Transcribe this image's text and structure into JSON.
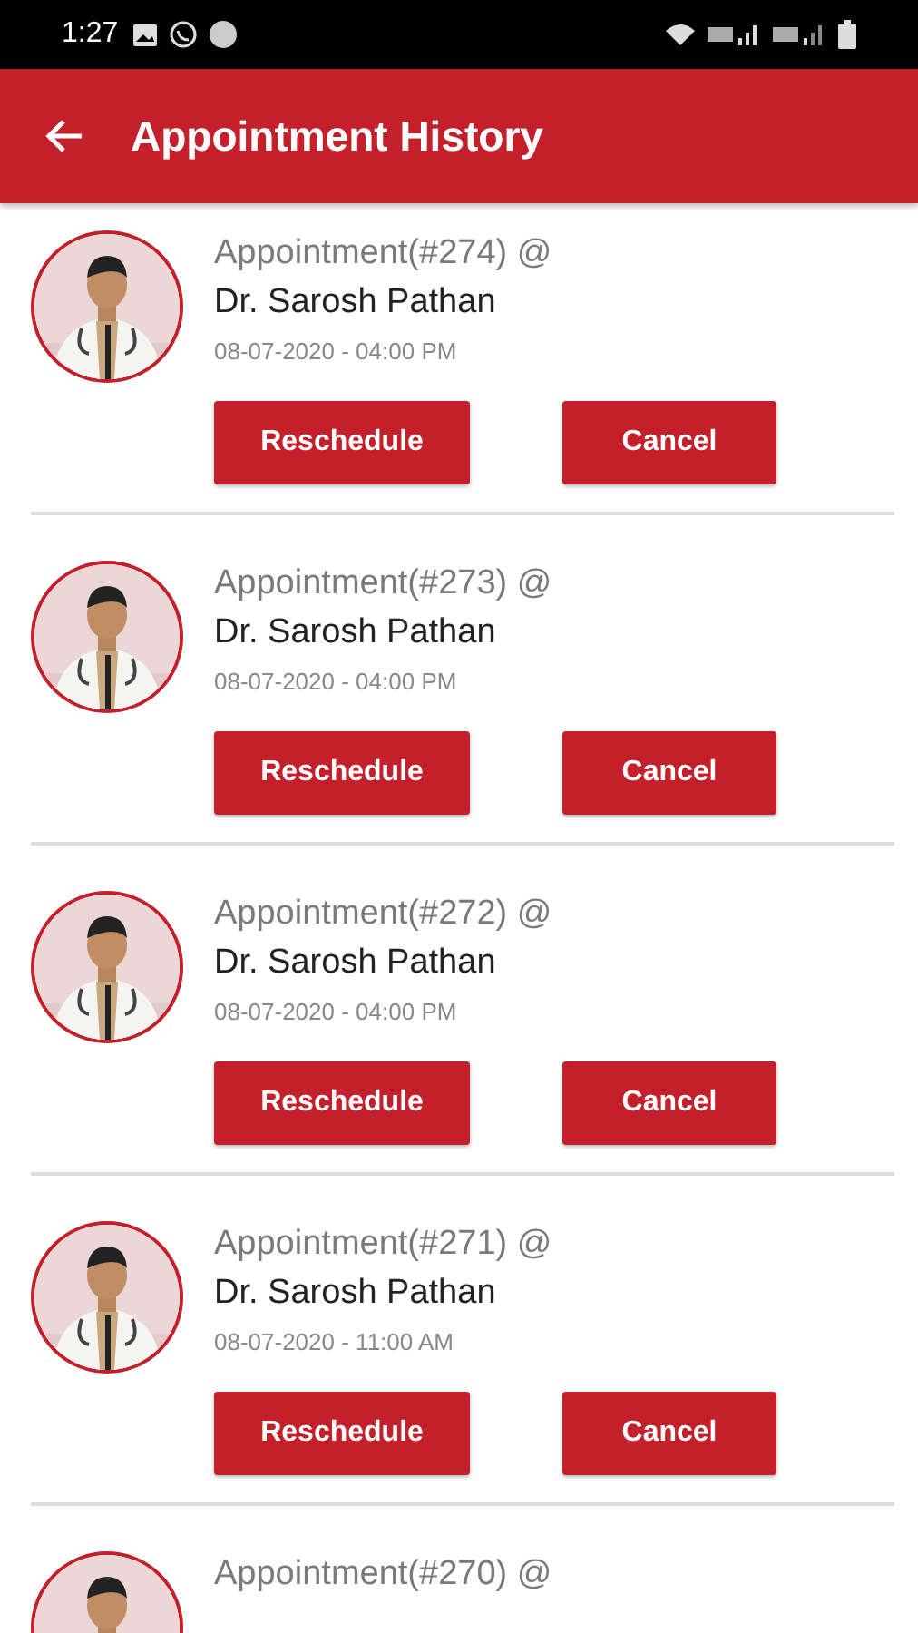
{
  "status_bar": {
    "time": "1:27"
  },
  "app_bar": {
    "title": "Appointment History"
  },
  "appointments": [
    {
      "title": "Appointment(#274) @",
      "doctor": "Dr. Sarosh Pathan",
      "datetime": "08-07-2020 - 04:00 PM",
      "actions": [
        "Reschedule",
        "Cancel"
      ]
    },
    {
      "title": "Appointment(#273) @",
      "doctor": "Dr. Sarosh Pathan",
      "datetime": "08-07-2020 - 04:00 PM",
      "actions": [
        "Reschedule",
        "Cancel"
      ]
    },
    {
      "title": "Appointment(#272) @",
      "doctor": "Dr. Sarosh Pathan",
      "datetime": "08-07-2020 - 04:00 PM",
      "actions": [
        "Reschedule",
        "Cancel"
      ]
    },
    {
      "title": "Appointment(#271) @",
      "doctor": "Dr. Sarosh Pathan",
      "datetime": "08-07-2020 - 11:00 AM",
      "actions": [
        "Reschedule",
        "Cancel"
      ]
    },
    {
      "title": "Appointment(#270) @"
    }
  ]
}
